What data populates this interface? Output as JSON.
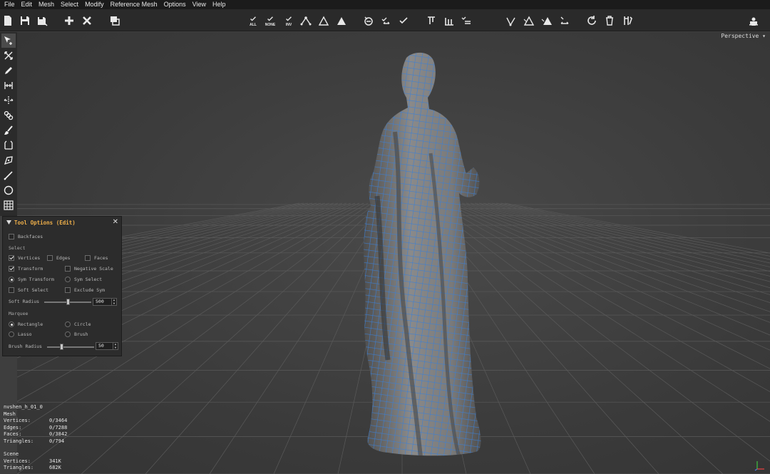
{
  "menu": [
    "File",
    "Edit",
    "Mesh",
    "Select",
    "Modify",
    "Reference Mesh",
    "Options",
    "View",
    "Help"
  ],
  "toolbar": {
    "new_icon": "new-file-icon",
    "save_icon": "save-icon",
    "save_as_icon": "save-as-icon",
    "add_icon": "plus-icon",
    "delete_icon": "close-icon",
    "layers_icon": "layers-icon",
    "select_all_caption": "ALL",
    "select_none_caption": "NONE",
    "select_invert_caption": "INV"
  },
  "viewport": {
    "perspective_label": "Perspective ▾"
  },
  "tool_options": {
    "title": "Tool Options (Edit)",
    "close": "✕",
    "backfaces": "Backfaces",
    "select_section": "Select",
    "vertices": "Vertices",
    "edges": "Edges",
    "faces": "Faces",
    "transform": "Transform",
    "negative_scale": "Negative Scale",
    "sym_transform": "Sym Transform",
    "sym_select": "Sym Select",
    "soft_select": "Soft Select",
    "exclude_sym": "Exclude Sym",
    "soft_radius_label": "Soft Radius",
    "soft_radius_value": "500",
    "marquee_section": "Marquee",
    "rectangle": "Rectangle",
    "circle": "Circle",
    "lasso": "Lasso",
    "brush": "Brush",
    "brush_radius_label": "Brush Radius",
    "brush_radius_value": "50",
    "soft_radius_fraction": 0.5,
    "brush_radius_fraction": 0.3
  },
  "stats": {
    "object_name": "nvshen_h_01_0",
    "mesh_label": "Mesh",
    "vertices_label": "Vertices:",
    "vertices_value": "0/3464",
    "edges_label": "Edges:",
    "edges_value": "0/7288",
    "faces_label": "Faces:",
    "faces_value": "0/3842",
    "triangles_label": "Triangles:",
    "triangles_value": "0/794",
    "scene_label": "Scene",
    "scene_vertices_label": "Vertices:",
    "scene_vertices_value": "341K",
    "scene_triangles_label": "Triangles:",
    "scene_triangles_value": "682K"
  },
  "colors": {
    "accent": "#f0b04a",
    "wire": "#3a7fd6",
    "statue": "#7a7a7a"
  }
}
